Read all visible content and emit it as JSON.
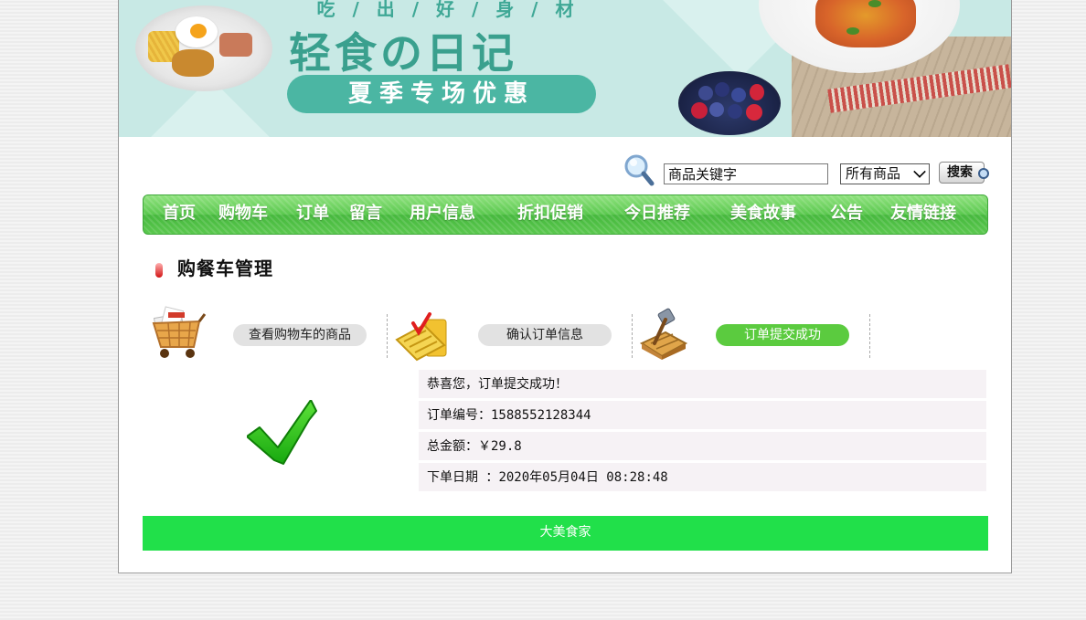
{
  "banner": {
    "slogan_top": "吃 / 出 / 好 / 身 / 材",
    "title": "轻食の日记",
    "promo": "夏季专场优惠"
  },
  "search": {
    "input_value": "商品关键字",
    "category": "所有商品",
    "button": "搜索"
  },
  "nav": {
    "items": [
      "首页",
      "购物车",
      "订单",
      "留言",
      "用户信息",
      "折扣促销",
      "今日推荐",
      "美食故事",
      "公告",
      "友情链接"
    ]
  },
  "section": {
    "title": "购餐车管理"
  },
  "steps": [
    {
      "label": "查看购物车的商品",
      "icon": "shopping-cart-icon",
      "active": false
    },
    {
      "label": "确认订单信息",
      "icon": "calculator-icon",
      "active": false
    },
    {
      "label": "订单提交成功",
      "icon": "hammer-tools-icon",
      "active": true
    }
  ],
  "order": {
    "success": "恭喜您，订单提交成功！",
    "number_label": "订单编号：",
    "number": "1588552128344",
    "total_label": "总金额：",
    "total": "￥29.8",
    "date_label": "下单日期 ：",
    "date": "2020年05月04日 08:28:48"
  },
  "footer": {
    "text": "大美食家"
  },
  "colors": {
    "nav_green": "#5ac84e",
    "footer_green": "#21e04a",
    "active_step": "#5bcb3f",
    "banner_bg": "#c8e9e5",
    "info_bg": "#f6f2f5"
  }
}
